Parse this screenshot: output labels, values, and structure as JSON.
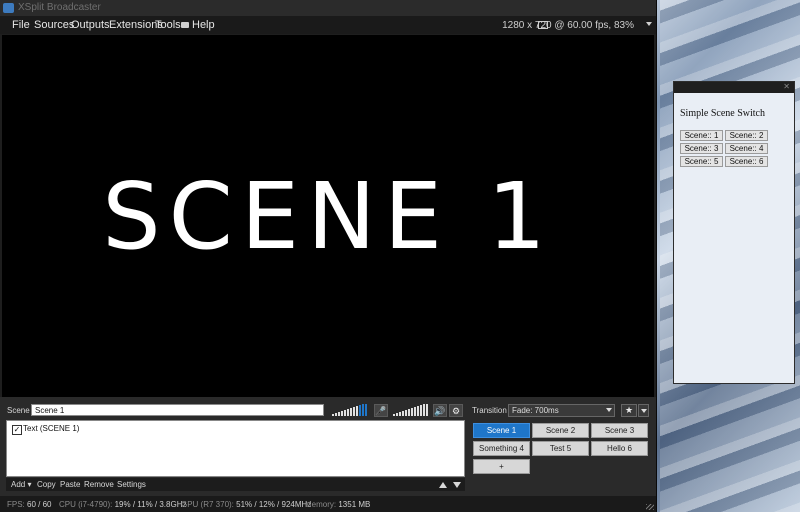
{
  "app": {
    "title": "XSplit Broadcaster",
    "menu": [
      "File",
      "Sources",
      "Outputs",
      "Extensions",
      "Tools",
      "Help"
    ],
    "resolution": "1280 x 720 @ 60.00 fps, 83%"
  },
  "preview": {
    "text": "SCENE 1"
  },
  "scene_bar": {
    "scene_label": "Scene",
    "scene_name": "Scene 1",
    "transition_label": "Transition",
    "transition_value": "Fade: 700ms"
  },
  "sources": {
    "items": [
      {
        "label": "Text (SCENE 1)",
        "checked": true
      }
    ],
    "toolbar": {
      "add": "Add ▾",
      "copy": "Copy",
      "paste": "Paste",
      "remove": "Remove",
      "settings": "Settings"
    }
  },
  "scenes": {
    "buttons": [
      "Scene 1",
      "Scene 2",
      "Scene 3",
      "Something 4",
      "Test 5",
      "Hello 6",
      "+"
    ],
    "active": "Scene 1"
  },
  "status": {
    "fps_label": "FPS:",
    "fps_value": "60 / 60",
    "cpu_label": "CPU (i7-4790):",
    "cpu_value": "19% / 11% / 3.8GHz",
    "gpu_label": "GPU (R7 370):",
    "gpu_value": "51% / 12% / 924MHz",
    "mem_label": "Memory:",
    "mem_value": "1351 MB"
  },
  "switcher": {
    "heading": "Simple Scene Switch",
    "buttons": [
      "Scene:: 1",
      "Scene:: 2",
      "Scene:: 3",
      "Scene:: 4",
      "Scene:: 5",
      "Scene:: 6"
    ]
  },
  "colors": {
    "accent": "#1f76c9",
    "app_bg": "#1e1e1e",
    "preview_bg": "#000000"
  },
  "icons": [
    "app-logo-icon",
    "help-icon",
    "monitor-icon",
    "microphone-icon",
    "speaker-icon",
    "gear-icon",
    "star-icon"
  ]
}
